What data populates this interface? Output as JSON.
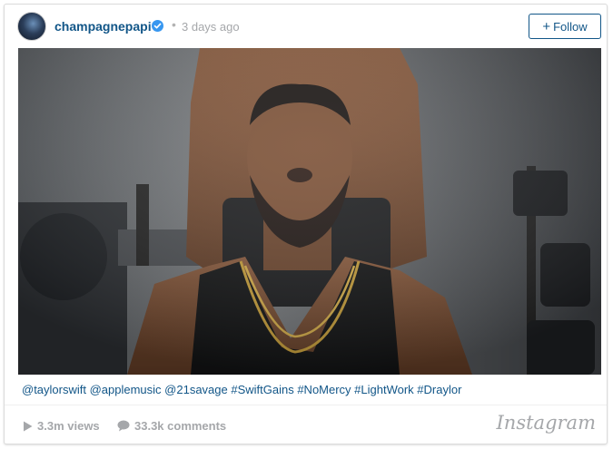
{
  "post": {
    "username": "champagnepapi",
    "separator": "•",
    "time_ago": "3 days ago",
    "follow_label": "Follow",
    "follow_icon": "plus",
    "caption": "@taylorswift @applemusic @21savage #SwiftGains #NoMercy #LightWork #Draylor",
    "views": "3.3m views",
    "comments": "33.3k comments",
    "brand": "Instagram"
  },
  "icons": {
    "verified": "verified-badge-icon",
    "views": "play-icon",
    "comments": "comment-bubble-icon"
  },
  "colors": {
    "link": "#125688",
    "muted": "#a5a7aa",
    "verified": "#3897f0"
  }
}
